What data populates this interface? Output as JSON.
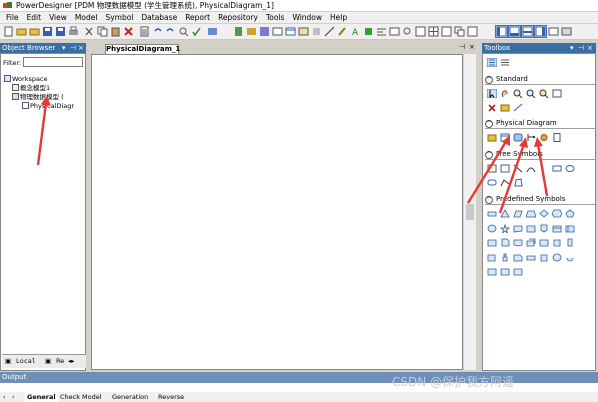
{
  "app": {
    "title": "PowerDesigner [PDM 物理数据模型 (学生管理系统), PhysicalDiagram_1]"
  },
  "menu": [
    {
      "label": "File"
    },
    {
      "label": "Edit"
    },
    {
      "label": "View"
    },
    {
      "label": "Model"
    },
    {
      "label": "Symbol"
    },
    {
      "label": "Database"
    },
    {
      "label": "Report"
    },
    {
      "label": "Repository"
    },
    {
      "label": "Tools"
    },
    {
      "label": "Window"
    },
    {
      "label": "Help"
    }
  ],
  "browser": {
    "title": "Object Browser",
    "filter_label": "Filter:",
    "filter_value": "",
    "tree": [
      {
        "label": "Workspace",
        "level": 0
      },
      {
        "label": "概念模型1",
        "level": 1
      },
      {
        "label": "物理数据模型 (",
        "level": 1
      },
      {
        "label": "PhysicalDiagr",
        "level": 2
      }
    ],
    "tabs": [
      {
        "label": "Local"
      },
      {
        "label": "Re"
      }
    ]
  },
  "document": {
    "tab_label": "PhysicalDiagram_1"
  },
  "toolbox": {
    "title": "Toolbox",
    "sections": [
      {
        "label": "Standard"
      },
      {
        "label": "Physical Diagram"
      },
      {
        "label": "Free Symbols"
      },
      {
        "label": "Predefined Symbols"
      }
    ]
  },
  "output": {
    "title": "Output",
    "tabs": [
      {
        "label": "General"
      },
      {
        "label": "Check Model"
      },
      {
        "label": "Generation"
      },
      {
        "label": "Reverse"
      }
    ]
  },
  "watermark": "CSDN @保护我方阿遥",
  "colors": {
    "panel_header": "#3a6ea5",
    "annotation_arrow": "#e53935",
    "output_header": "#6d8fb8"
  }
}
